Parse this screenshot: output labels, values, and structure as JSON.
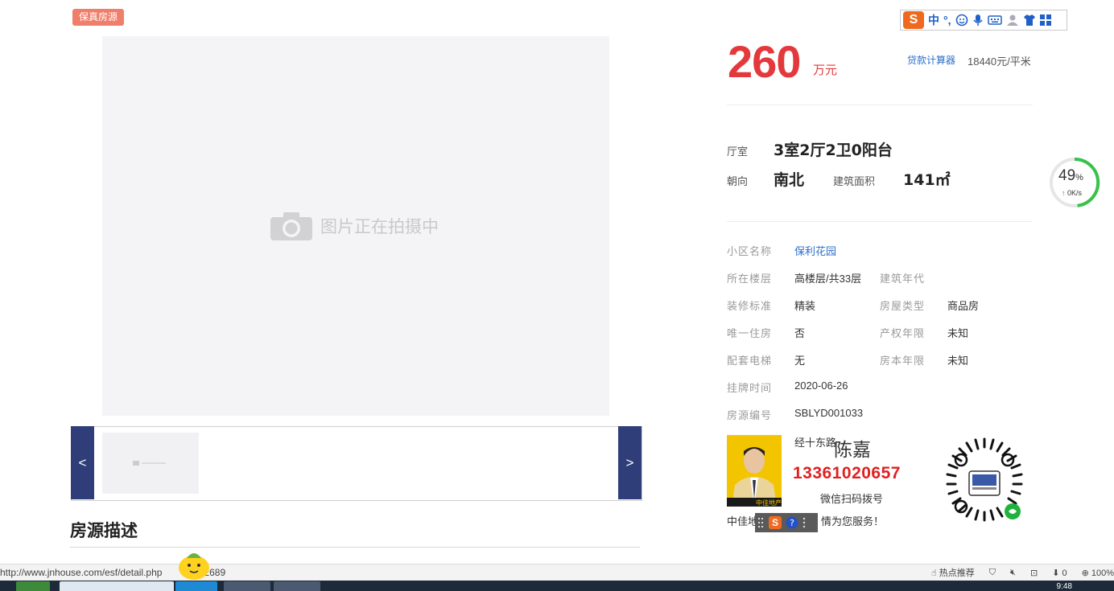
{
  "tag": "保真房源",
  "photo": {
    "placeholder": "图片正在拍摄中",
    "prev": "<",
    "next": ">"
  },
  "description_title": "房源描述",
  "price": {
    "value": "260",
    "unit": "万元",
    "calc_link": "贷款计算器",
    "unit_price": "18440元/平米"
  },
  "layout": {
    "room_label": "厅室",
    "room_value": "3室2厅2卫0阳台",
    "orient_label": "朝向",
    "orient_value": "南北",
    "area_label": "建筑面积",
    "area_value": "141㎡"
  },
  "details": {
    "community_label": "小区名称",
    "community_value": "保利花园",
    "floor_label": "所在楼层",
    "floor_value": "高楼层/共33层",
    "year_label": "建筑年代",
    "decor_label": "装修标准",
    "decor_value": "精装",
    "type_label": "房屋类型",
    "type_value": "商品房",
    "only_label": "唯一住房",
    "only_value": "否",
    "rights_label": "产权年限",
    "rights_value": "未知",
    "elevator_label": "配套电梯",
    "elevator_value": "无",
    "cert_label": "房本年限",
    "cert_value": "未知",
    "listed_label": "挂牌时间",
    "listed_value": "2020-06-26",
    "code_label": "房源编号",
    "code_value": "SBLYD001033"
  },
  "agent": {
    "company_prefix": "经十东路",
    "name": "陈嘉",
    "phone": "13361020657",
    "scan": "微信扫码拨号",
    "service_prefix": "中佳地",
    "service_suffix": "情为您服务！",
    "badge": "中佳地产"
  },
  "ime": {
    "lang": "中",
    "punct": "°,",
    "logo": "S"
  },
  "speed": {
    "percent": "49",
    "pct_sign": "%",
    "rate": "0K/s"
  },
  "status": {
    "url": "http://www.jnhouse.com/esf/detail.php",
    "url_tail": "2689",
    "hot": "热点推荐",
    "downloads": "0",
    "zoom": "100%"
  },
  "clock": "9:48"
}
